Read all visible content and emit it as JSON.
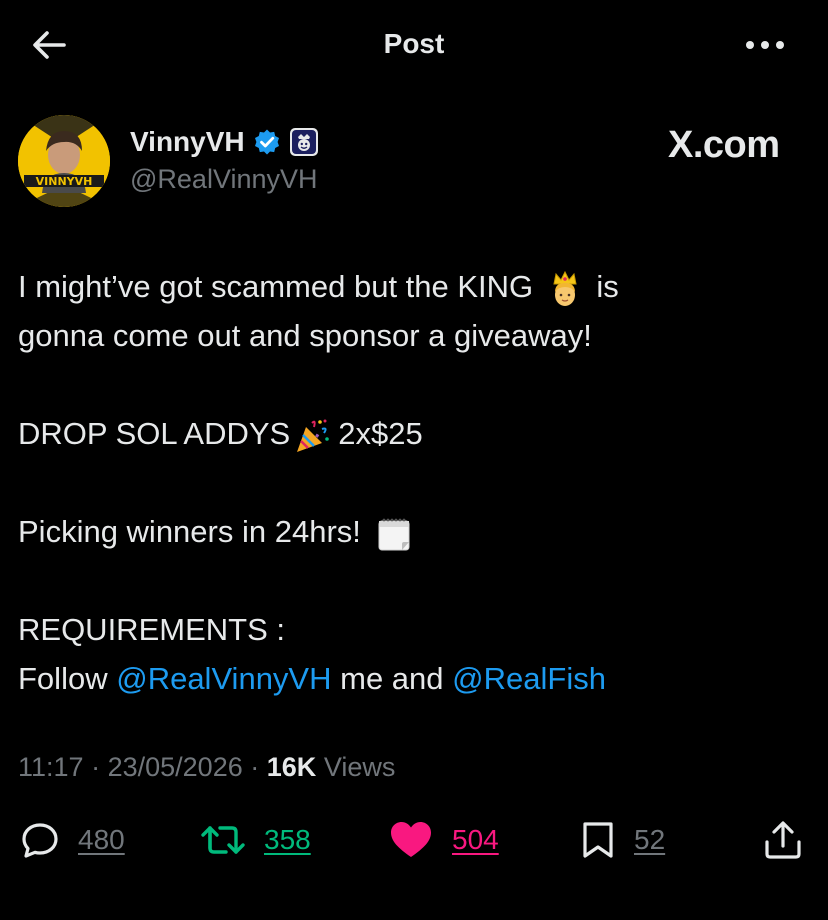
{
  "topbar": {
    "title": "Post",
    "back_icon": "arrow-left-icon",
    "more_icon": "more-horizontal-icon"
  },
  "author": {
    "display_name": "VinnyVH",
    "handle": "@RealVinnyVH",
    "avatar_text": "VINNYVH",
    "verified_icon": "verified-badge-icon",
    "affiliate_icon": "affiliate-badge-icon"
  },
  "watermark": "X.com",
  "post": {
    "line1_a": "I might’ve got scammed but the KING",
    "line1_b": "is",
    "line2": "gonna come out and sponsor a giveaway!",
    "drop_line_a": "DROP SOL ADDYS",
    "drop_line_b": "2x$25",
    "picking_line": "Picking winners in 24hrs!",
    "requirements_heading": "REQUIREMENTS :",
    "follow_prefix": "Follow",
    "mention_1": "@RealVinnyVH",
    "follow_middle": "me and",
    "mention_2": "@RealFish"
  },
  "meta": {
    "time": "11:17",
    "separator": "·",
    "date": "23/05/2026",
    "views_count": "16K",
    "views_label": "Views"
  },
  "actions": {
    "replies": "480",
    "reposts": "358",
    "likes": "504",
    "bookmarks": "52"
  },
  "colors": {
    "background": "#000000",
    "text": "#e7e9ea",
    "muted": "#71767b",
    "link": "#1d9bf0",
    "repost": "#00ba7c",
    "like": "#f91880",
    "avatar_bg": "#f2c200"
  }
}
